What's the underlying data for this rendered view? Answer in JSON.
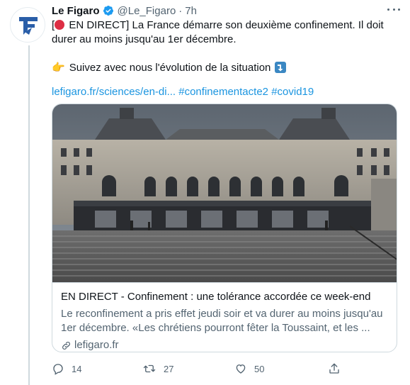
{
  "tweet": {
    "author_name": "Le Figaro",
    "author_handle": "@Le_Figaro",
    "separator": "·",
    "time": "7h",
    "text_line1_a": "[",
    "text_line1_b": " EN DIRECT] La France démarre son deuxième confinement. Il doit",
    "text_line2": "durer au moins jusqu'au 1er décembre.",
    "hand_emoji": "👉",
    "text_line3": "Suivez avec nous l'évolution de la situation",
    "link_url": "lefigaro.fr/sciences/en-di...",
    "hashtag1": "#confinementacte2",
    "hashtag2": "#covid19"
  },
  "card": {
    "title": "EN DIRECT - Confinement : une tolérance accordée ce week-end",
    "description": "Le reconfinement a pris effet jeudi soir et va durer au moins jusqu'au 1er décembre. «Les chrétiens pourront fêter la Toussaint, et les ...",
    "domain": "lefigaro.fr",
    "image_description": "Musée d'Orsay facade with empty stone steps"
  },
  "actions": {
    "replies": "14",
    "retweets": "27",
    "likes": "50"
  },
  "icons": {
    "avatar": "le-figaro-logo",
    "verified": "verified-badge-icon",
    "more": "more-options-icon",
    "reply": "reply-icon",
    "retweet": "retweet-icon",
    "like": "heart-icon",
    "share": "share-icon",
    "link": "link-icon",
    "red_circle": "red-circle-emoji",
    "arrow": "arrow-down-emoji"
  },
  "colors": {
    "link": "#1b95e0",
    "verified": "#1d9bf0",
    "secondary_text": "#536471",
    "border": "#cfd9de",
    "logo_blue": "#2a5ea8"
  }
}
